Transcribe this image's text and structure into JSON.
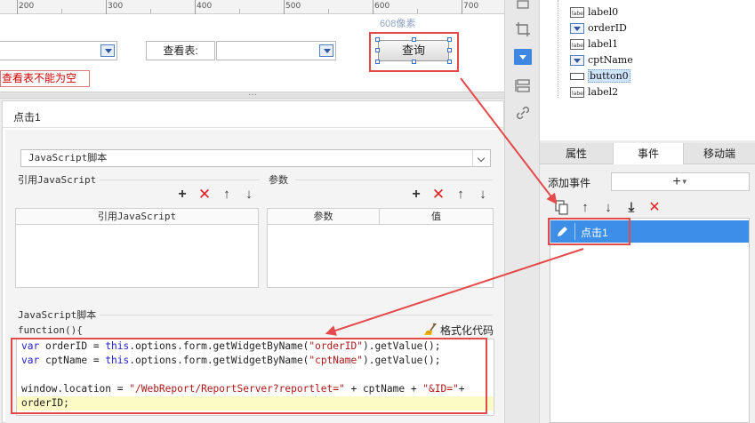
{
  "ruler": {
    "labels": [
      "200",
      "300",
      "400",
      "500",
      "600",
      "700"
    ]
  },
  "canvas": {
    "query_table_label": "查看表:",
    "size_tip": "608像素",
    "query_button": "查询",
    "error_text": "查看表不能为空"
  },
  "event_panel": {
    "title": "点击1",
    "script_type": "JavaScript脚本",
    "ref_js_label": "引用JavaScript",
    "params_label": "参数",
    "ref_js_column": "引用JavaScript",
    "param_columns": [
      "参数",
      "值"
    ],
    "script_label": "JavaScript脚本",
    "function_header": "function(){",
    "format_code": "格式化代码",
    "code": {
      "line1": {
        "kw1": "var",
        "t1": " orderID = ",
        "kw2": "this",
        "t2": ".options.form.getWidgetByName(",
        "s1": "\"orderID\"",
        "t3": ").getValue();"
      },
      "line2": {
        "kw1": "var",
        "t1": " cptName = ",
        "kw2": "this",
        "t2": ".options.form.getWidgetByName(",
        "s1": "\"cptName\"",
        "t3": ").getValue();"
      },
      "line4": {
        "t1": "window.location = ",
        "s1": "\"/WebReport/ReportServer?reportlet=\"",
        "t2": " + cptName + ",
        "s2": "\"&ID=\"",
        "t3": "+"
      },
      "line5": {
        "t1": "orderID;"
      }
    }
  },
  "widget_tree": {
    "items": [
      {
        "icon": "label-icon",
        "label": "label0"
      },
      {
        "icon": "combobox-icon",
        "label": "orderID"
      },
      {
        "icon": "label-icon",
        "label": "label1"
      },
      {
        "icon": "combobox-icon",
        "label": "cptName"
      },
      {
        "icon": "button-icon",
        "label": "button0"
      },
      {
        "icon": "label-icon",
        "label": "label2"
      }
    ],
    "selected": "button0"
  },
  "property_tabs": [
    "属性",
    "事件",
    "移动端"
  ],
  "active_tab": "事件",
  "events": {
    "add_label": "添加事件",
    "add_button": "+",
    "list": [
      "点击1"
    ]
  },
  "colors": {
    "highlight_red": "#e44a4a",
    "selection_blue": "#3c8ee6",
    "delete_red": "#e02020",
    "keyword_blue": "#2222c8",
    "string_red": "#b01818"
  }
}
